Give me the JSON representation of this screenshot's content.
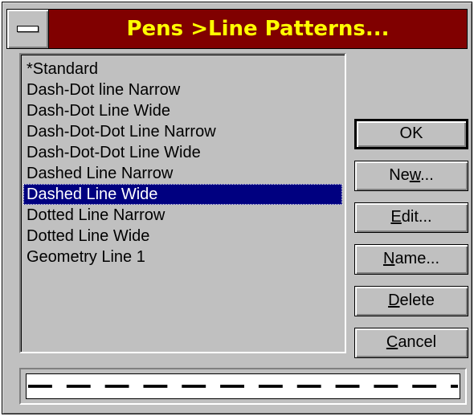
{
  "window": {
    "title": "Pens >Line Patterns...",
    "system_menu_icon": "system-menu-icon"
  },
  "list": {
    "items": [
      "*Standard",
      "Dash-Dot line Narrow",
      "Dash-Dot Line Wide",
      "Dash-Dot-Dot Line Narrow",
      "Dash-Dot-Dot Line Wide",
      "Dashed Line Narrow",
      "Dashed Line Wide",
      "Dotted Line Narrow",
      "Dotted Line Wide",
      "Geometry Line 1"
    ],
    "selected_index": 6
  },
  "buttons": {
    "ok": {
      "pre": "",
      "accel": "",
      "post": "OK"
    },
    "new": {
      "pre": "Ne",
      "accel": "w",
      "post": "..."
    },
    "edit": {
      "pre": "",
      "accel": "E",
      "post": "dit..."
    },
    "name": {
      "pre": "",
      "accel": "N",
      "post": "ame..."
    },
    "delete": {
      "pre": "",
      "accel": "D",
      "post": "elete"
    },
    "cancel": {
      "pre": "",
      "accel": "C",
      "post": "ancel"
    }
  },
  "preview": {
    "pattern": "dashed-wide",
    "line_color": "#000000"
  },
  "colors": {
    "title_bg": "#800000",
    "title_text": "#ffff00",
    "face": "#c0c0c0",
    "selection": "#000080"
  }
}
